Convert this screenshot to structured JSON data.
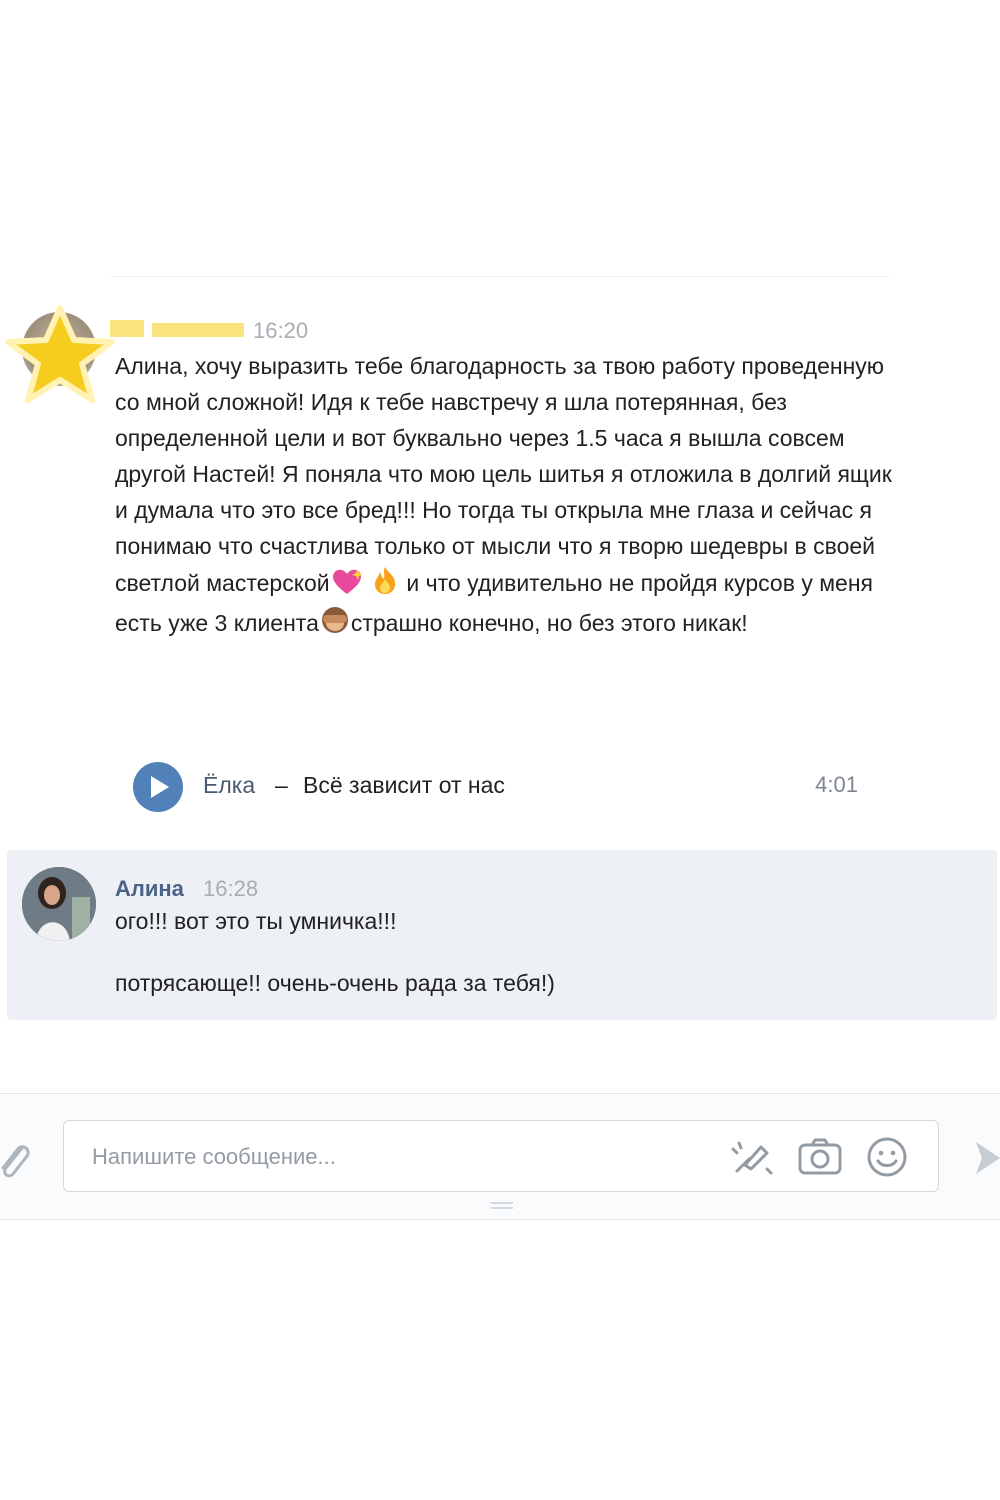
{
  "messages": [
    {
      "author": "",
      "time": "16:20",
      "text": "Алина, хочу выразить тебе благодарность за твою работу проведенную со мной сложной! Идя к тебе навстречу я шла потерянная, без определенной цели и вот буквально через 1.5 часа я вышла совсем другой Настей! Я поняла что мою цель шитья я отложила в долгий ящик и думала что это все бред!!! Но тогда ты открыла мне глаза и сейчас я понимаю что счастлива только от мысли что я творю шедевры в своей светлой мастерской",
      "text_mid": " и что удивительно не пройдя курсов у меня есть уже 3 клиента",
      "text_end": "страшно конечно, но без этого никак!",
      "attachment": {
        "artist": "Ёлка",
        "separator": "–",
        "title": "Всё зависит от нас",
        "duration": "4:01"
      }
    },
    {
      "author": "Алина",
      "time": "16:28",
      "lines": [
        "ого!!! вот это ты умничка!!!",
        "потрясающе!! очень-очень рада за тебя!)"
      ]
    }
  ],
  "composer": {
    "placeholder": "Напишите сообщение..."
  },
  "icons": {
    "avatar_overlay": "star-icon",
    "play": "play-icon",
    "attach": "paperclip-icon",
    "graffiti": "graffiti-icon",
    "camera": "camera-icon",
    "emoji": "smile-icon",
    "send": "send-icon"
  },
  "colors": {
    "accent": "#5181b8",
    "author_link": "#4a6386",
    "highlight_background": "#edf0f5",
    "redaction": "#fbe47f"
  }
}
